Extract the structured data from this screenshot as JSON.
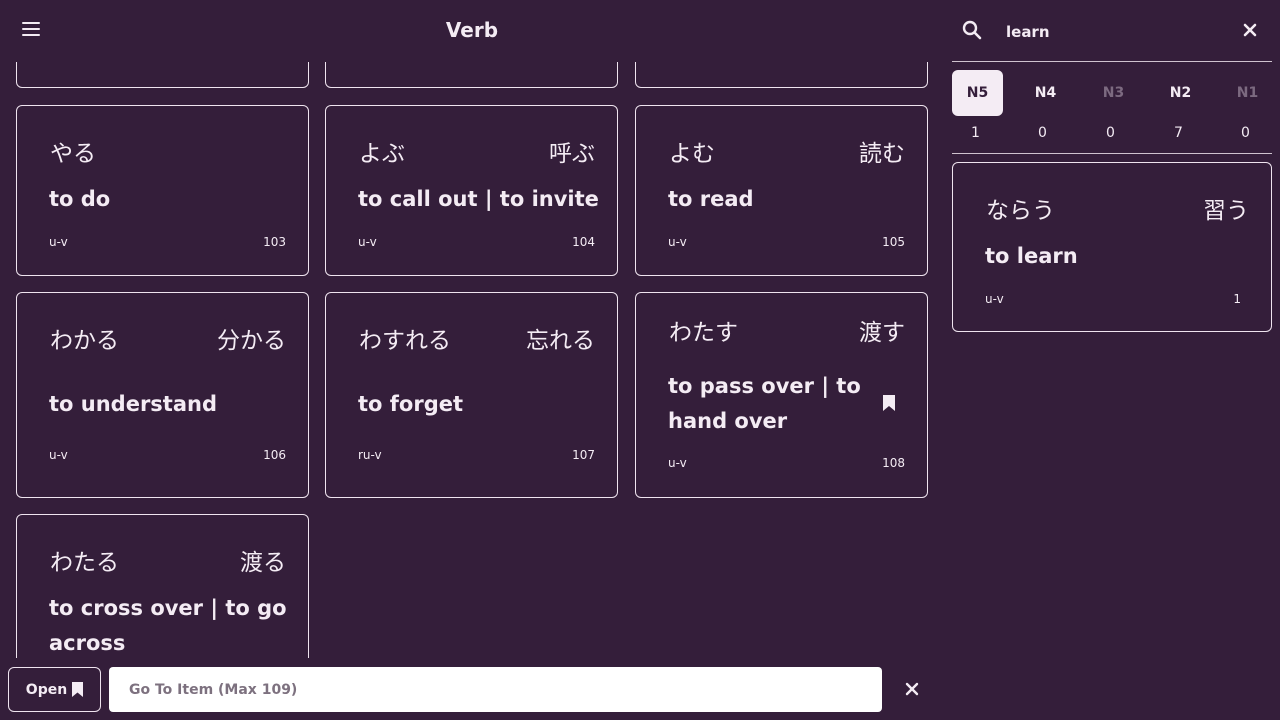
{
  "header": {
    "title": "Verb",
    "menu_icon": "hamburger-menu-icon"
  },
  "cards": [
    {
      "kana": "",
      "kanji": "",
      "meaning": "",
      "pos": "",
      "num": ""
    },
    {
      "kana": "",
      "kanji": "",
      "meaning": "",
      "pos": "",
      "num": ""
    },
    {
      "kana": "",
      "kanji": "",
      "meaning": "",
      "pos": "",
      "num": ""
    },
    {
      "kana": "やる",
      "kanji": "",
      "meaning": "to do",
      "pos": "u-v",
      "num": "103"
    },
    {
      "kana": "よぶ",
      "kanji": "呼ぶ",
      "meaning": "to call out | to invite",
      "pos": "u-v",
      "num": "104"
    },
    {
      "kana": "よむ",
      "kanji": "読む",
      "meaning": "to read",
      "pos": "u-v",
      "num": "105"
    },
    {
      "kana": "わかる",
      "kanji": "分かる",
      "meaning": "to understand",
      "pos": "u-v",
      "num": "106"
    },
    {
      "kana": "わすれる",
      "kanji": "忘れる",
      "meaning": "to forget",
      "pos": "ru-v",
      "num": "107"
    },
    {
      "kana": "わたす",
      "kanji": "渡す",
      "meaning": "to pass over | to hand over",
      "pos": "u-v",
      "num": "108",
      "bookmarked": true
    },
    {
      "kana": "わたる",
      "kanji": "渡る",
      "meaning": "to cross over | to go across",
      "pos": "",
      "num": ""
    }
  ],
  "search": {
    "value": "learn",
    "icon": "search-icon",
    "clear_icon": "close-icon"
  },
  "levels": [
    {
      "label": "N5",
      "count": "1",
      "state": "active"
    },
    {
      "label": "N4",
      "count": "0",
      "state": "normal"
    },
    {
      "label": "N3",
      "count": "0",
      "state": "disabled"
    },
    {
      "label": "N2",
      "count": "7",
      "state": "normal"
    },
    {
      "label": "N1",
      "count": "0",
      "state": "disabled"
    }
  ],
  "result": {
    "kana": "ならう",
    "kanji": "習う",
    "meaning": "to learn",
    "pos": "u-v",
    "num": "1"
  },
  "footer": {
    "open_label": "Open",
    "open_icon": "bookmark-icon",
    "goto_placeholder": "Go To Item (Max 109)",
    "clear_icon": "close-icon"
  },
  "colors": {
    "background": "#341e3a",
    "foreground": "#f4ecf4",
    "muted": "#7c6a80"
  }
}
